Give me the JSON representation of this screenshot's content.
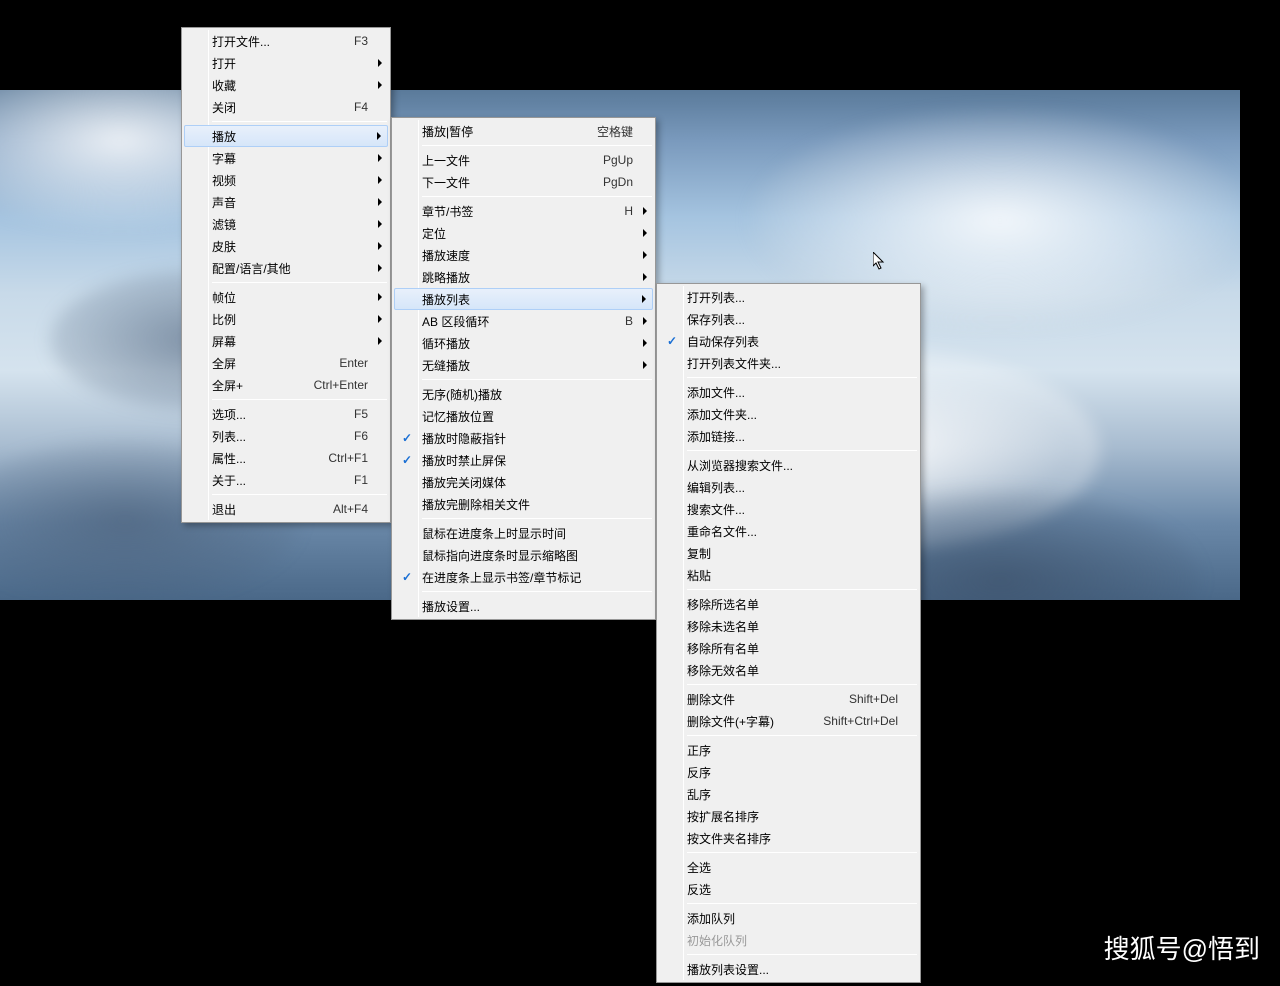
{
  "watermark": "搜狐号@悟到",
  "menu1": {
    "items": [
      {
        "label": "打开文件...",
        "shortcut": "F3"
      },
      {
        "label": "打开",
        "arrow": true
      },
      {
        "label": "收藏",
        "arrow": true
      },
      {
        "label": "关闭",
        "shortcut": "F4"
      },
      {
        "sep": true
      },
      {
        "label": "播放",
        "arrow": true,
        "highlighted": true
      },
      {
        "label": "字幕",
        "arrow": true
      },
      {
        "label": "视频",
        "arrow": true
      },
      {
        "label": "声音",
        "arrow": true
      },
      {
        "label": "滤镜",
        "arrow": true
      },
      {
        "label": "皮肤",
        "arrow": true
      },
      {
        "label": "配置/语言/其他",
        "arrow": true
      },
      {
        "sep": true
      },
      {
        "label": "帧位",
        "arrow": true
      },
      {
        "label": "比例",
        "arrow": true
      },
      {
        "label": "屏幕",
        "arrow": true
      },
      {
        "label": "全屏",
        "shortcut": "Enter"
      },
      {
        "label": "全屏+",
        "shortcut": "Ctrl+Enter"
      },
      {
        "sep": true
      },
      {
        "label": "选项...",
        "shortcut": "F5"
      },
      {
        "label": "列表...",
        "shortcut": "F6"
      },
      {
        "label": "属性...",
        "shortcut": "Ctrl+F1"
      },
      {
        "label": "关于...",
        "shortcut": "F1"
      },
      {
        "sep": true
      },
      {
        "label": "退出",
        "shortcut": "Alt+F4"
      }
    ]
  },
  "menu2": {
    "items": [
      {
        "label": "播放|暂停",
        "shortcut": "空格键"
      },
      {
        "sep": true
      },
      {
        "label": "上一文件",
        "shortcut": "PgUp"
      },
      {
        "label": "下一文件",
        "shortcut": "PgDn"
      },
      {
        "sep": true
      },
      {
        "label": "章节/书签",
        "shortcut": "H",
        "arrow": true
      },
      {
        "label": "定位",
        "arrow": true
      },
      {
        "label": "播放速度",
        "arrow": true
      },
      {
        "label": "跳略播放",
        "arrow": true
      },
      {
        "label": "播放列表",
        "arrow": true,
        "highlighted": true
      },
      {
        "label": "AB 区段循环",
        "shortcut": "B",
        "arrow": true
      },
      {
        "label": "循环播放",
        "arrow": true
      },
      {
        "label": "无缝播放",
        "arrow": true
      },
      {
        "sep": true
      },
      {
        "label": "无序(随机)播放"
      },
      {
        "label": "记忆播放位置"
      },
      {
        "label": "播放时隐蔽指针",
        "checked": true
      },
      {
        "label": "播放时禁止屏保",
        "checked": true
      },
      {
        "label": "播放完关闭媒体"
      },
      {
        "label": "播放完删除相关文件"
      },
      {
        "sep": true
      },
      {
        "label": "鼠标在进度条上时显示时间"
      },
      {
        "label": "鼠标指向进度条时显示缩略图"
      },
      {
        "label": "在进度条上显示书签/章节标记",
        "checked": true
      },
      {
        "sep": true
      },
      {
        "label": "播放设置..."
      }
    ]
  },
  "menu3": {
    "items": [
      {
        "label": "打开列表..."
      },
      {
        "label": "保存列表..."
      },
      {
        "label": "自动保存列表",
        "checked": true
      },
      {
        "label": "打开列表文件夹..."
      },
      {
        "sep": true
      },
      {
        "label": "添加文件..."
      },
      {
        "label": "添加文件夹..."
      },
      {
        "label": "添加链接..."
      },
      {
        "sep": true
      },
      {
        "label": "从浏览器搜索文件..."
      },
      {
        "label": "编辑列表..."
      },
      {
        "label": "搜索文件..."
      },
      {
        "label": "重命名文件..."
      },
      {
        "label": "复制"
      },
      {
        "label": "粘贴"
      },
      {
        "sep": true
      },
      {
        "label": "移除所选名单"
      },
      {
        "label": "移除未选名单"
      },
      {
        "label": "移除所有名单"
      },
      {
        "label": "移除无效名单"
      },
      {
        "sep": true
      },
      {
        "label": "删除文件",
        "shortcut": "Shift+Del"
      },
      {
        "label": "删除文件(+字幕)",
        "shortcut": "Shift+Ctrl+Del"
      },
      {
        "sep": true
      },
      {
        "label": "正序"
      },
      {
        "label": "反序"
      },
      {
        "label": "乱序"
      },
      {
        "label": "按扩展名排序"
      },
      {
        "label": "按文件夹名排序"
      },
      {
        "sep": true
      },
      {
        "label": "全选"
      },
      {
        "label": "反选"
      },
      {
        "sep": true
      },
      {
        "label": "添加队列"
      },
      {
        "label": "初始化队列",
        "disabled": true
      },
      {
        "sep": true
      },
      {
        "label": "播放列表设置..."
      }
    ]
  }
}
